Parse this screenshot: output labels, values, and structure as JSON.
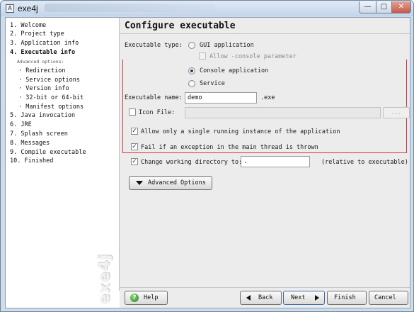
{
  "window": {
    "title": "exe4j",
    "app_icon": "A",
    "min_glyph": "—",
    "max_glyph": "□",
    "close_glyph": "✕"
  },
  "sidebar": {
    "steps": [
      {
        "label": "1. Welcome"
      },
      {
        "label": "2. Project type"
      },
      {
        "label": "3. Application info"
      },
      {
        "label": "4. Executable info"
      }
    ],
    "advanced_label": "Advanced options:",
    "sub_steps": [
      {
        "label": "· Redirection"
      },
      {
        "label": "· Service options"
      },
      {
        "label": "· Version info"
      },
      {
        "label": "· 32-bit or 64-bit"
      },
      {
        "label": "· Manifest options"
      }
    ],
    "steps_after": [
      {
        "label": "5. Java invocation"
      },
      {
        "label": "6. JRE"
      },
      {
        "label": "7. Splash screen"
      },
      {
        "label": "8. Messages"
      },
      {
        "label": "9. Compile executable"
      },
      {
        "label": "10. Finished"
      }
    ],
    "brand": "exe4j"
  },
  "main": {
    "title": "Configure executable",
    "executable_type_label": "Executable type:",
    "types": {
      "gui": "GUI application",
      "allow_console": "Allow -console parameter",
      "console": "Console application",
      "service": "Service"
    },
    "selected_type": "console",
    "executable_name_label": "Executable name:",
    "executable_name_value": "demo",
    "exe_suffix": ".exe",
    "icon_file_label": "Icon File:",
    "icon_file_value": "",
    "browse_label": "...",
    "single_instance_label": "Allow only a single running instance of the application",
    "single_instance_checked": true,
    "fail_on_exception_label": "Fail if an exception in the main thread is thrown",
    "fail_on_exception_checked": true,
    "change_dir_label": "Change working directory to:",
    "change_dir_checked": true,
    "working_dir_value": ".",
    "relative_note": "(relative to executable)",
    "advanced_button": "Advanced Options"
  },
  "footer": {
    "help": "Help",
    "back": "Back",
    "next": "Next",
    "finish": "Finish",
    "cancel": "Cancel"
  },
  "check_glyph": "✓",
  "help_glyph": "?",
  "colors": {
    "highlight_border": "#e0303a",
    "radio_dot": "#1c3f73"
  }
}
